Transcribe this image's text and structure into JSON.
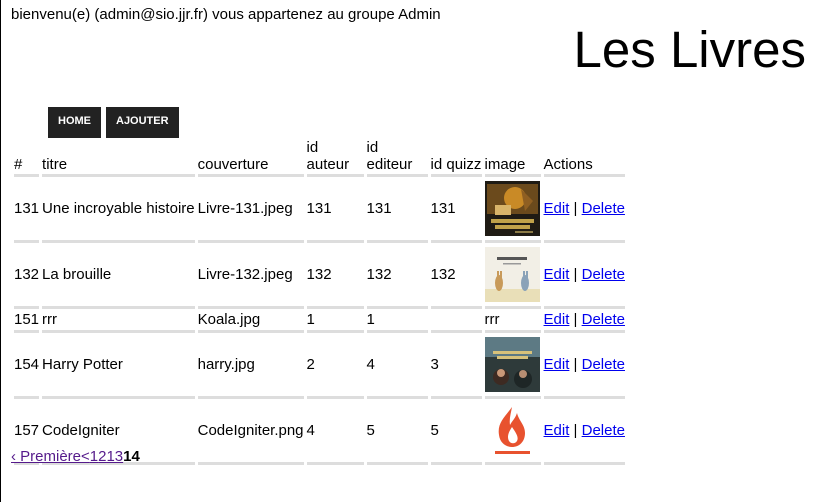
{
  "header": {
    "welcome": "bienvenu(e) (admin@sio.jjr.fr) vous appartenez au groupe Admin",
    "title": "Les Livres"
  },
  "nav": {
    "home": "HOME",
    "add": "AJOUTER"
  },
  "table": {
    "headers": [
      "#",
      "titre",
      "couverture",
      "id auteur",
      "id editeur",
      "id quizz",
      "image",
      "Actions"
    ],
    "rows": [
      {
        "id": "131",
        "titre": "Une incroyable histoire",
        "couverture": "Livre-131.jpeg",
        "id_auteur": "131",
        "id_editeur": "131",
        "id_quizz": "131",
        "image_text": "",
        "image": "cover-incroyable-histoire"
      },
      {
        "id": "132",
        "titre": "La brouille",
        "couverture": "Livre-132.jpeg",
        "id_auteur": "132",
        "id_editeur": "132",
        "id_quizz": "132",
        "image_text": "",
        "image": "cover-la-brouille"
      },
      {
        "id": "151",
        "titre": "rrr",
        "couverture": "Koala.jpg",
        "id_auteur": "1",
        "id_editeur": "1",
        "id_quizz": "",
        "image_text": "rrr",
        "image": ""
      },
      {
        "id": "154",
        "titre": "Harry Potter",
        "couverture": "harry.jpg",
        "id_auteur": "2",
        "id_editeur": "4",
        "id_quizz": "3",
        "image_text": "",
        "image": "cover-harry-potter"
      },
      {
        "id": "157",
        "titre": "CodeIgniter",
        "couverture": "CodeIgniter.png",
        "id_auteur": "4",
        "id_editeur": "5",
        "id_quizz": "5",
        "image_text": "",
        "image": "codeigniter-logo"
      }
    ],
    "edit_label": "Edit",
    "separator": " | ",
    "delete_label": "Delete"
  },
  "pagination": {
    "first": "‹ Première",
    "prev": "<",
    "page1": "1",
    "page2": "2",
    "page3": "13",
    "current": "14"
  },
  "colors": {
    "nav_bg": "#222222",
    "link": "#0000ee",
    "visited_link": "#551a8b",
    "row_border": "#dddddd"
  }
}
